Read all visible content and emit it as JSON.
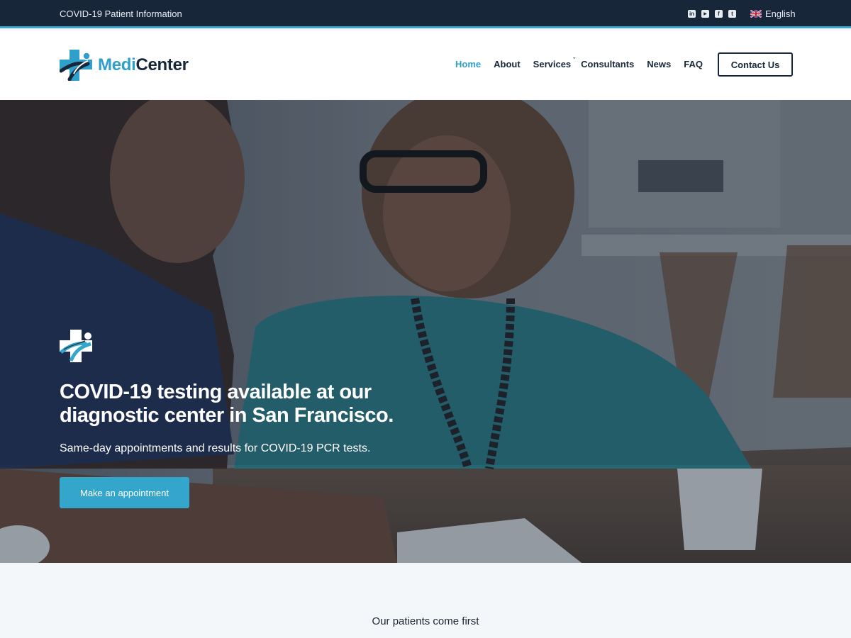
{
  "topbar": {
    "info_text": "COVID-19 Patient Information",
    "socials": [
      {
        "name": "linkedin-icon",
        "glyph": "in"
      },
      {
        "name": "youtube-icon",
        "glyph": "▶"
      },
      {
        "name": "facebook-icon",
        "glyph": "f"
      },
      {
        "name": "twitter-icon",
        "glyph": "t"
      }
    ],
    "language": {
      "label": "English",
      "flag": "uk-flag-icon"
    }
  },
  "header": {
    "logo": {
      "part1": "Medi",
      "part2": "Center"
    },
    "nav": [
      {
        "label": "Home",
        "active": true
      },
      {
        "label": "About"
      },
      {
        "label": "Services",
        "has_dropdown": true,
        "caret": "ˇ"
      },
      {
        "label": "Consultants"
      },
      {
        "label": "News"
      },
      {
        "label": "FAQ"
      }
    ],
    "contact_label": "Contact Us"
  },
  "hero": {
    "title": "COVID-19 testing available at our diagnostic center in San Francisco.",
    "subtitle": "Same-day appointments and results for COVID-19 PCR tests.",
    "button_label": "Make an appointment"
  },
  "section": {
    "tagline": "Our patients come first"
  },
  "colors": {
    "topbar_bg": "#172638",
    "accent": "#35a6cb",
    "brand_dark": "#172638",
    "page_bg": "#f4f7f9"
  }
}
